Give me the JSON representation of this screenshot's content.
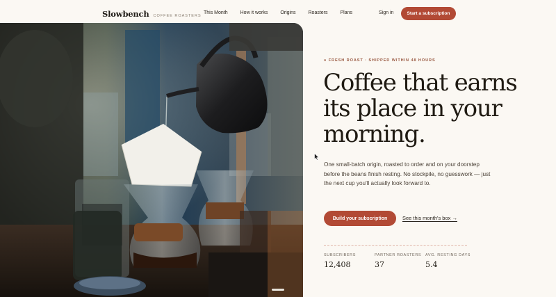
{
  "brand": {
    "name": "Slowbench",
    "tagline": "COFFEE ROASTERS"
  },
  "nav": {
    "items": [
      {
        "label": "This Month"
      },
      {
        "label": "How it works"
      },
      {
        "label": "Origins"
      },
      {
        "label": "Roasters"
      },
      {
        "label": "Plans"
      }
    ],
    "signin": "Sign in",
    "cta": "Start a subscription"
  },
  "hero": {
    "eyebrow": "● FRESH ROAST · SHIPPED WITHIN 48 HOURS",
    "headline": "Coffee that earns its place in your morning.",
    "lede": "One small-batch origin, roasted to order and on your doorstep before the beans finish resting. No stockpile, no guesswork — just the next cup you'll actually look forward to.",
    "primary_cta": "Build your subscription",
    "secondary_cta": "See this month's box →"
  },
  "stats": [
    {
      "label": "SUBSCRIBERS",
      "value": "12,408"
    },
    {
      "label": "PARTNER ROASTERS",
      "value": "37"
    },
    {
      "label": "AVG. RESTING DAYS",
      "value": "5.4"
    }
  ],
  "colors": {
    "accent": "#b24a35",
    "background": "#fbf8f3",
    "text": "#1f1a12"
  },
  "icons": [
    "arrow-right-icon",
    "cursor-icon"
  ]
}
